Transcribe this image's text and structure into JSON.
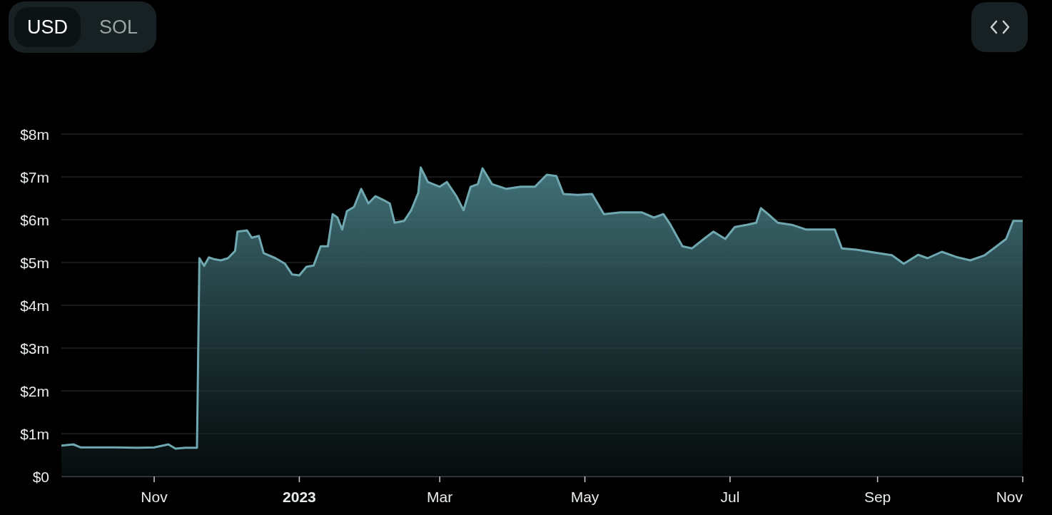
{
  "currency_toggle": [
    {
      "label": "USD",
      "selected": true
    },
    {
      "label": "SOL",
      "selected": false
    }
  ],
  "chart": {
    "chart_data": {
      "type": "area",
      "x": [
        "2022-09-23",
        "2022-09-28",
        "2022-10-01",
        "2022-10-07",
        "2022-10-16",
        "2022-10-25",
        "2022-11-01",
        "2022-11-07",
        "2022-11-10",
        "2022-11-14",
        "2022-11-19",
        "2022-11-20",
        "2022-11-22",
        "2022-11-24",
        "2022-11-26",
        "2022-11-29",
        "2022-12-02",
        "2022-12-05",
        "2022-12-06",
        "2022-12-10",
        "2022-12-12",
        "2022-12-15",
        "2022-12-17",
        "2022-12-22",
        "2022-12-26",
        "2022-12-29",
        "2023-01-01",
        "2023-01-04",
        "2023-01-07",
        "2023-01-10",
        "2023-01-13",
        "2023-01-15",
        "2023-01-17",
        "2023-01-19",
        "2023-01-21",
        "2023-01-24",
        "2023-01-27",
        "2023-01-30",
        "2023-02-02",
        "2023-02-05",
        "2023-02-08",
        "2023-02-10",
        "2023-02-14",
        "2023-02-17",
        "2023-02-20",
        "2023-02-21",
        "2023-02-24",
        "2023-03-01",
        "2023-03-04",
        "2023-03-08",
        "2023-03-11",
        "2023-03-14",
        "2023-03-17",
        "2023-03-19",
        "2023-03-23",
        "2023-03-29",
        "2023-04-04",
        "2023-04-10",
        "2023-04-15",
        "2023-04-19",
        "2023-04-22",
        "2023-04-28",
        "2023-05-04",
        "2023-05-09",
        "2023-05-16",
        "2023-05-25",
        "2023-05-30",
        "2023-06-03",
        "2023-06-06",
        "2023-06-11",
        "2023-06-15",
        "2023-06-20",
        "2023-06-24",
        "2023-06-29",
        "2023-07-03",
        "2023-07-08",
        "2023-07-12",
        "2023-07-14",
        "2023-07-17",
        "2023-07-21",
        "2023-07-27",
        "2023-08-02",
        "2023-08-08",
        "2023-08-14",
        "2023-08-17",
        "2023-08-23",
        "2023-09-01",
        "2023-09-07",
        "2023-09-12",
        "2023-09-18",
        "2023-09-22",
        "2023-09-28",
        "2023-10-04",
        "2023-10-10",
        "2023-10-16",
        "2023-10-21",
        "2023-10-25",
        "2023-10-28",
        "2023-11-01"
      ],
      "series": [
        {
          "color": "#6fa8b0",
          "values": [
            0.72,
            0.75,
            0.68,
            0.68,
            0.68,
            0.67,
            0.68,
            0.75,
            0.65,
            0.67,
            0.67,
            5.1,
            4.92,
            5.12,
            5.08,
            5.05,
            5.1,
            5.27,
            5.72,
            5.75,
            5.58,
            5.62,
            5.22,
            5.1,
            4.97,
            4.72,
            4.7,
            4.9,
            4.93,
            5.38,
            5.38,
            6.13,
            6.05,
            5.77,
            6.2,
            6.3,
            6.72,
            6.38,
            6.55,
            6.47,
            6.38,
            5.93,
            5.97,
            6.22,
            6.63,
            7.22,
            6.88,
            6.77,
            6.88,
            6.55,
            6.22,
            6.77,
            6.83,
            7.2,
            6.83,
            6.72,
            6.77,
            6.77,
            7.05,
            7.02,
            6.6,
            6.58,
            6.6,
            6.13,
            6.17,
            6.17,
            6.05,
            6.13,
            5.88,
            5.38,
            5.33,
            5.55,
            5.72,
            5.55,
            5.83,
            5.88,
            5.93,
            6.27,
            6.13,
            5.93,
            5.88,
            5.77,
            5.77,
            5.77,
            5.33,
            5.3,
            5.22,
            5.17,
            4.97,
            5.18,
            5.1,
            5.25,
            5.13,
            5.05,
            5.17,
            5.38,
            5.55,
            5.97,
            5.97
          ]
        }
      ],
      "grid": true,
      "xlim": [
        "2022-09-23",
        "2023-11-01"
      ],
      "ylim": [
        0,
        8
      ],
      "xticks": [
        {
          "value": "2022-11-01",
          "label": "Nov"
        },
        {
          "value": "2023-01-01",
          "label": "2023"
        },
        {
          "value": "2023-03-01",
          "label": "Mar"
        },
        {
          "value": "2023-05-01",
          "label": "May"
        },
        {
          "value": "2023-07-01",
          "label": "Jul"
        },
        {
          "value": "2023-09-01",
          "label": "Sep"
        },
        {
          "value": "2023-11-01",
          "label": "Nov"
        }
      ],
      "yticks": [
        {
          "value": 0,
          "label": "$0"
        },
        {
          "value": 1,
          "label": "$1m"
        },
        {
          "value": 2,
          "label": "$2m"
        },
        {
          "value": 3,
          "label": "$3m"
        },
        {
          "value": 4,
          "label": "$4m"
        },
        {
          "value": 5,
          "label": "$5m"
        },
        {
          "value": 6,
          "label": "$6m"
        },
        {
          "value": 7,
          "label": "$7m"
        },
        {
          "value": 8,
          "label": "$8m"
        }
      ]
    }
  }
}
